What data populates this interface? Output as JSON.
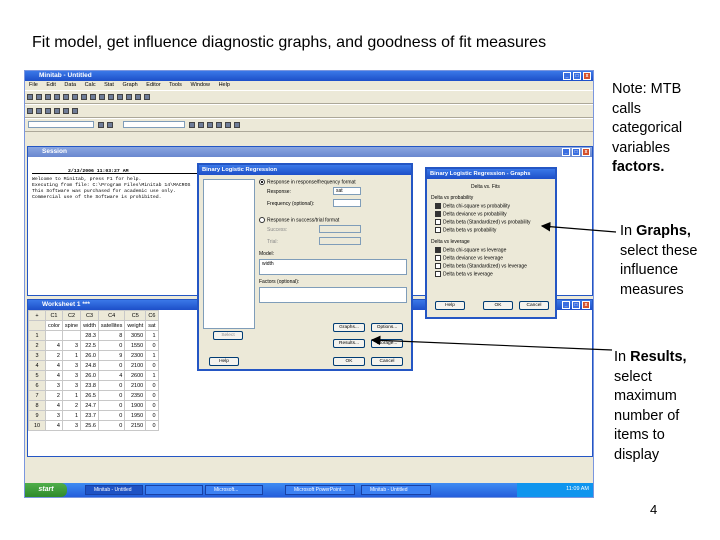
{
  "slide": {
    "title": "Fit model, get influence diagnostic graphs, and goodness of fit measures",
    "page_number": "4",
    "note_factors": {
      "line1": "Note: MTB",
      "line2": "calls",
      "line3": "categorical",
      "line4": "variables",
      "line5": "factors."
    },
    "note_graphs": {
      "line1_prefix": "In ",
      "line1_bold": "Graphs,",
      "line2": "select these",
      "line3": "influence",
      "line4": "measures"
    },
    "note_results": {
      "line1_prefix": "In ",
      "line1_bold": "Results,",
      "line2": "select",
      "line3": "maximum",
      "line4": "number of",
      "line5": "items to",
      "line6": "display"
    }
  },
  "app": {
    "title": "Minitab - Untitled",
    "menu": [
      "File",
      "Edit",
      "Data",
      "Calc",
      "Stat",
      "Graph",
      "Editor",
      "Tools",
      "Window",
      "Help"
    ]
  },
  "session": {
    "title": "Session",
    "timestamp": "2/13/2006 11:03:27 AM",
    "lines": [
      "Welcome to Minitab, press F1 for help.",
      "Executing from file: C:\\Program Files\\Minitab 14\\MACROS",
      "",
      "This Software was purchased for academic use only.",
      "Commercial use of the Software is prohibited."
    ]
  },
  "worksheet": {
    "title": "Worksheet 1 ***",
    "col_ids": [
      "C1",
      "C2",
      "C3",
      "C4",
      "C5",
      "C6"
    ],
    "col_names": [
      "color",
      "spine",
      "width",
      "satellites",
      "weight",
      "sat"
    ],
    "rows": [
      [
        "1",
        "",
        "",
        "28.3",
        "8",
        "3050",
        "1"
      ],
      [
        "2",
        "4",
        "3",
        "22.5",
        "0",
        "1550",
        "0"
      ],
      [
        "3",
        "2",
        "1",
        "26.0",
        "9",
        "2300",
        "1"
      ],
      [
        "4",
        "4",
        "3",
        "24.8",
        "0",
        "2100",
        "0"
      ],
      [
        "5",
        "4",
        "3",
        "26.0",
        "4",
        "2600",
        "1"
      ],
      [
        "6",
        "3",
        "3",
        "23.8",
        "0",
        "2100",
        "0"
      ],
      [
        "7",
        "2",
        "1",
        "26.5",
        "0",
        "2350",
        "0"
      ],
      [
        "8",
        "4",
        "2",
        "24.7",
        "0",
        "1900",
        "0"
      ],
      [
        "9",
        "3",
        "1",
        "23.7",
        "0",
        "1950",
        "0"
      ],
      [
        "10",
        "4",
        "3",
        "25.6",
        "0",
        "2150",
        "0"
      ]
    ]
  },
  "binary_dialog": {
    "title": "Binary Logistic Regression",
    "opt_response": "Response in response/frequency format",
    "response_label": "Response:",
    "response_value": "sat",
    "frequency_label": "Frequency (optional):",
    "opt_success": "Response in success/trial format",
    "success_label": "Success:",
    "trial_label": "Trial:",
    "model_label": "Model:",
    "model_value": "width",
    "factors_label": "Factors (optional):",
    "select_btn": "Select",
    "graphs_btn": "Graphs...",
    "options_btn": "Options...",
    "results_btn": "Results...",
    "storage_btn": "Storage...",
    "help_btn": "Help",
    "ok_btn": "OK",
    "cancel_btn": "Cancel"
  },
  "graphs_dialog": {
    "title": "Binary Logistic Regression - Graphs",
    "x_label": "Delta vs. Fits",
    "group1": "Delta vs probability",
    "items1": [
      "Delta chi-square vs probability",
      "Delta deviance vs probability",
      "Delta beta (Standardized) vs probability",
      "Delta beta vs probability"
    ],
    "group2": "Delta vs leverage",
    "items2": [
      "Delta chi-square vs leverage",
      "Delta deviance vs leverage",
      "Delta beta (Standardized) vs leverage",
      "Delta beta vs leverage"
    ],
    "help_btn": "Help",
    "ok_btn": "OK",
    "cancel_btn": "Cancel"
  },
  "taskbar": {
    "start": "start",
    "tasks": [
      "Minitab - Untitled",
      "",
      "Microsoft...",
      "Microsoft PowerPoint...",
      "Minitab - Untitled"
    ],
    "clock": "11:09 AM"
  }
}
